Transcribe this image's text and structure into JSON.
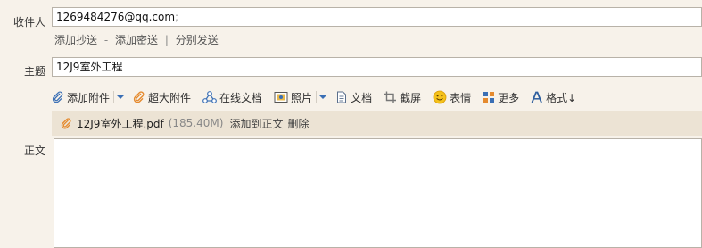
{
  "recipients": {
    "label": "收件人",
    "value": "1269484276@qq.com",
    "separator": ";"
  },
  "links": {
    "add_cc": "添加抄送",
    "dash": "-",
    "add_bcc": "添加密送",
    "pipe": "|",
    "send_separately": "分别发送"
  },
  "subject": {
    "label": "主题",
    "value": "12J9室外工程"
  },
  "toolbar": {
    "add_attachment": "添加附件",
    "large_attachment": "超大附件",
    "online_doc": "在线文档",
    "photo": "照片",
    "document": "文档",
    "screenshot": "截屏",
    "emoji": "表情",
    "more": "更多",
    "format": "格式↓"
  },
  "attachment": {
    "filename": "12J9室外工程.pdf",
    "size": "(185.40M)",
    "add_to_body": "添加到正文",
    "delete": "删除"
  },
  "body": {
    "label": "正文",
    "value": ""
  },
  "colors": {
    "background": "#f7f2ea",
    "attachment_bar": "#ece3d4",
    "icon_blue": "#3a6fb5",
    "icon_orange": "#e58a2e"
  }
}
